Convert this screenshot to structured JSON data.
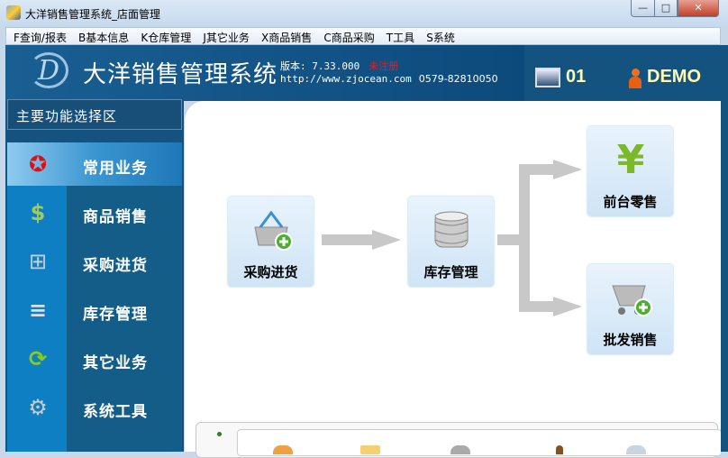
{
  "window": {
    "title": "大洋销售管理系统_店面管理",
    "minimize": "—",
    "maximize": "□",
    "close": "✕"
  },
  "menu": [
    "F查询/报表",
    "B基本信息",
    "K仓库管理",
    "J其它业务",
    "X商品销售",
    "C商品采购",
    "T工具",
    "S系统"
  ],
  "header": {
    "logo_letter": "D",
    "app_title": "大洋销售管理系统",
    "version": "版本: 7.33.000",
    "unregistered": "未注册",
    "url": "http://www.zjocean.com",
    "phone": "0579-82810050",
    "station": "01",
    "user": "DEMO"
  },
  "sidebar": {
    "title": "主要功能选择区",
    "items": [
      {
        "label": "常用业务",
        "icon": "ribbon-award-icon",
        "glyph": "🎖"
      },
      {
        "label": "商品销售",
        "icon": "dollar-icon",
        "glyph": "$"
      },
      {
        "label": "采购进货",
        "icon": "basket-add-icon",
        "glyph": "🧺"
      },
      {
        "label": "库存管理",
        "icon": "database-icon",
        "glyph": "≡"
      },
      {
        "label": "其它业务",
        "icon": "refresh-arrows-icon",
        "glyph": "⟳"
      },
      {
        "label": "系统工具",
        "icon": "gear-icon",
        "glyph": "⚙"
      }
    ]
  },
  "flow": {
    "purchase": "采购进货",
    "inventory": "库存管理",
    "retail": "前台零售",
    "wholesale": "批发销售"
  },
  "colors": {
    "header": "#14527f",
    "icon_column": "#0e7fc2",
    "label_column": "#135d88",
    "label_text_yellow": "#fffbb0",
    "unregistered": "#e02020"
  }
}
